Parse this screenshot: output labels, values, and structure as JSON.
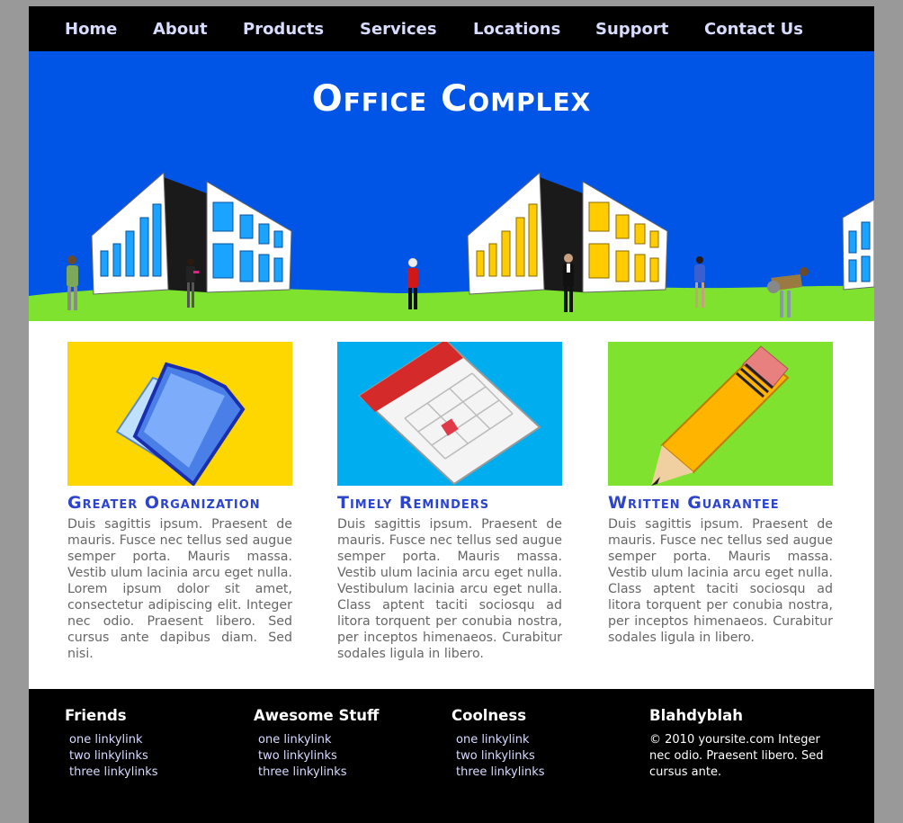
{
  "nav": {
    "items": [
      {
        "label": "Home"
      },
      {
        "label": "About"
      },
      {
        "label": "Products"
      },
      {
        "label": "Services"
      },
      {
        "label": "Locations"
      },
      {
        "label": "Support"
      },
      {
        "label": "Contact Us"
      }
    ]
  },
  "header": {
    "title": "Office Complex"
  },
  "features": [
    {
      "icon": "folder-icon",
      "bg_color": "#ffd700",
      "title": "Greater Organization",
      "text": "Duis sagittis ipsum. Praesent de mauris. Fusce nec tellus sed augue semper porta. Mauris massa. Vestib ulum lacinia arcu eget nulla. Lorem ipsum dolor sit amet, consectetur adipiscing elit. Integer nec odio. Praesent libero. Sed cursus ante dapibus diam. Sed nisi."
    },
    {
      "icon": "calendar-icon",
      "bg_color": "#00aeef",
      "title": "Timely Reminders",
      "text": "Duis sagittis ipsum. Praesent de mauris. Fusce nec tellus sed augue semper porta. Mauris massa. Vestib ulum lacinia arcu eget nulla. Vestibulum lacinia arcu eget nulla. Class aptent taciti sociosqu ad litora torquent per conubia nostra, per inceptos himenaeos. Curabitur sodales ligula in libero."
    },
    {
      "icon": "pencil-icon",
      "bg_color": "#7ee22e",
      "title": "Written Guarantee",
      "text": "Duis sagittis ipsum. Praesent de mauris. Fusce nec tellus sed augue semper porta. Mauris massa. Vestib ulum lacinia arcu eget nulla. Class aptent taciti sociosqu ad litora torquent per conubia nostra, per inceptos himenaeos. Curabitur sodales ligula in libero."
    }
  ],
  "footer": {
    "columns": [
      {
        "heading": "Friends",
        "links": [
          "one linkylink",
          "two linkylinks",
          "three linkylinks"
        ]
      },
      {
        "heading": "Awesome Stuff",
        "links": [
          "one linkylink",
          "two linkylinks",
          "three linkylinks"
        ]
      },
      {
        "heading": "Coolness",
        "links": [
          "one linkylink",
          "two linkylinks",
          "three linkylinks"
        ]
      }
    ],
    "about": {
      "heading": "Blahdyblah",
      "text": "© 2010 yoursite.com Integer nec odio. Praesent libero. Sed cursus ante."
    }
  },
  "colors": {
    "page_bg": "#999999",
    "nav_bg": "#000000",
    "nav_link": "#d8dcff",
    "header_bg": "#0055e6",
    "grass": "#7ee22e",
    "feature_title": "#2d44cf",
    "body_text": "#666666"
  }
}
